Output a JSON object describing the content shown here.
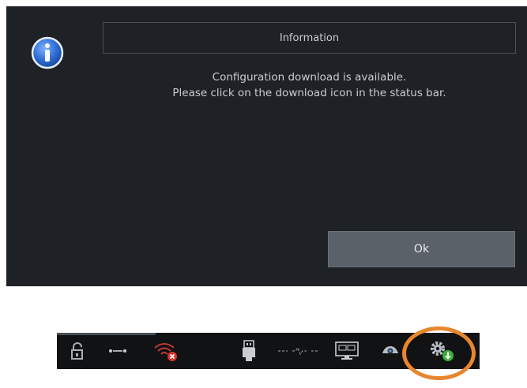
{
  "dialog": {
    "title": "Information",
    "message_line1": "Configuration download is available.",
    "message_line2": "Please click on the download icon in the status bar.",
    "ok_label": "Ok",
    "icon": "info-icon"
  },
  "status_bar": {
    "icons": [
      "lock-open-icon",
      "network-dots-icon",
      "wifi-error-icon",
      "usb-icon",
      "network-disconnected-icon",
      "display-icon",
      "eye-cloud-icon",
      "config-download-icon"
    ],
    "highlight_color": "#e8862e"
  },
  "colors": {
    "dialog_bg": "#1e2125",
    "button_bg": "#5a6168",
    "info_blue": "#2f6fd6",
    "error_red": "#d9342b",
    "success_green": "#3fae3a"
  }
}
